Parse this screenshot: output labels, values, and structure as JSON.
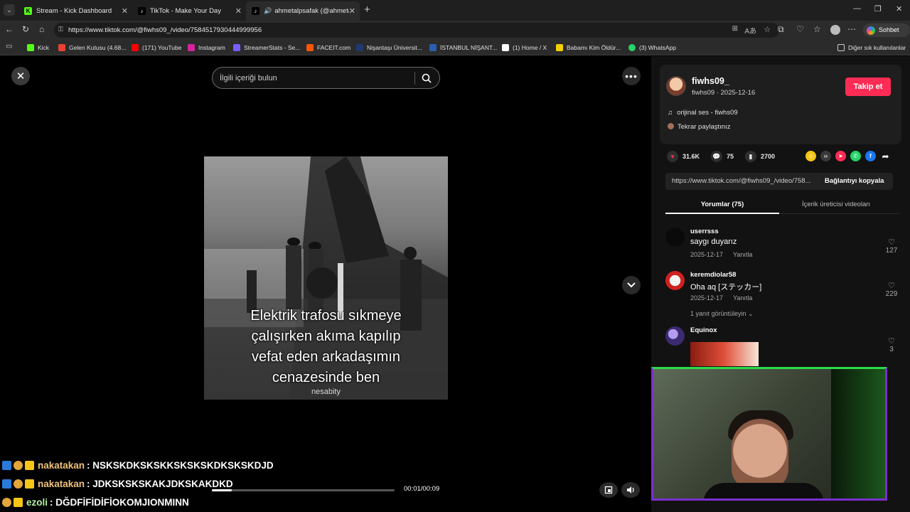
{
  "browser": {
    "tabs": [
      {
        "label": "Stream - Kick Dashboard",
        "icon": "kick-icon"
      },
      {
        "label": "TikTok - Make Your Day",
        "icon": "tiktok-icon"
      },
      {
        "label": "ahmetalpsafak (@ahmetalpsa",
        "icon": "tiktok-icon"
      }
    ],
    "url": "https://www.tiktok.com/@fiwhs09_/video/7584517930444999956",
    "sohbet_label": "Sohbet et",
    "bookmarks": [
      {
        "label": "Kick",
        "color": "#53fc18"
      },
      {
        "label": "Gelen Kutusu (4.68...",
        "color": "#ea4335"
      },
      {
        "label": "(171) YouTube",
        "color": "#ff0000"
      },
      {
        "label": "Instagram",
        "color": "#d6249f"
      },
      {
        "label": "StreamerStats - Se...",
        "color": "#7b5cff"
      },
      {
        "label": "FACEIT.com",
        "color": "#ff5500"
      },
      {
        "label": "Nişantaşı Üniversit...",
        "color": "#1e3a6e"
      },
      {
        "label": "İSTANBUL NİŞANT...",
        "color": "#2a5fb0"
      },
      {
        "label": "(1) Home / X",
        "color": "#ffffff"
      },
      {
        "label": "Babamı Kim Öldür...",
        "color": "#f5d000"
      },
      {
        "label": "(3) WhatsApp",
        "color": "#25d366"
      }
    ],
    "other_bookmarks": "Diğer sık kullanılanlar"
  },
  "video": {
    "search_placeholder": "İlgili içeriği bulun",
    "caption_lines": [
      "Elektrik trafosu sıkmeye",
      "çalışırken akıma kapılıp",
      "vefat eden arkadaşımın",
      "cenazesinde ben"
    ],
    "watermark": "nesabity",
    "time": "00:01/00:09",
    "progress": 0.11
  },
  "author": {
    "username": "fiwhs09_",
    "sub": "fiwhs09 · 2025-12-16",
    "follow_label": "Takip et",
    "music": "orijinal ses - fiwhs09",
    "repost": "Tekrar paylaştınız"
  },
  "stats": {
    "likes": "31.6K",
    "comments": "75",
    "saves": "2700"
  },
  "share_colors": [
    "#f5c518",
    "#3a3a3a",
    "#fe2c55",
    "#25d366",
    "#1877f2"
  ],
  "link": {
    "text": "https://www.tiktok.com/@fiwhs09_/video/758...",
    "copy_label": "Bağlantıyı kopyala"
  },
  "panel_tabs": {
    "comments": "Yorumlar (75)",
    "creator": "İçerik üreticisi videoları"
  },
  "comments": [
    {
      "user": "userrsss",
      "text": "saygı duyarız",
      "date": "2025-12-17",
      "reply": "Yanıtla",
      "likes": "127"
    },
    {
      "user": "keremdiolar58",
      "text": "Oha aq [ステッカー]",
      "date": "2025-12-17",
      "reply": "Yanıtla",
      "likes": "229",
      "view_replies": "1 yanıt görüntüleyin"
    },
    {
      "user": "Equinox",
      "text": "",
      "likes": "3"
    }
  ],
  "chat": [
    {
      "nick": "nakatakan",
      "message": ": NSKSKDKSKSKKSKSKSKDKSKSKDJD"
    },
    {
      "nick": "nakatakan",
      "message": ": JDKSKSKSKAKJDKSKAKDKD"
    },
    {
      "nick": "ezoli",
      "message": ": DĞDFİFİDİFİOKOMJIONMINN"
    }
  ]
}
